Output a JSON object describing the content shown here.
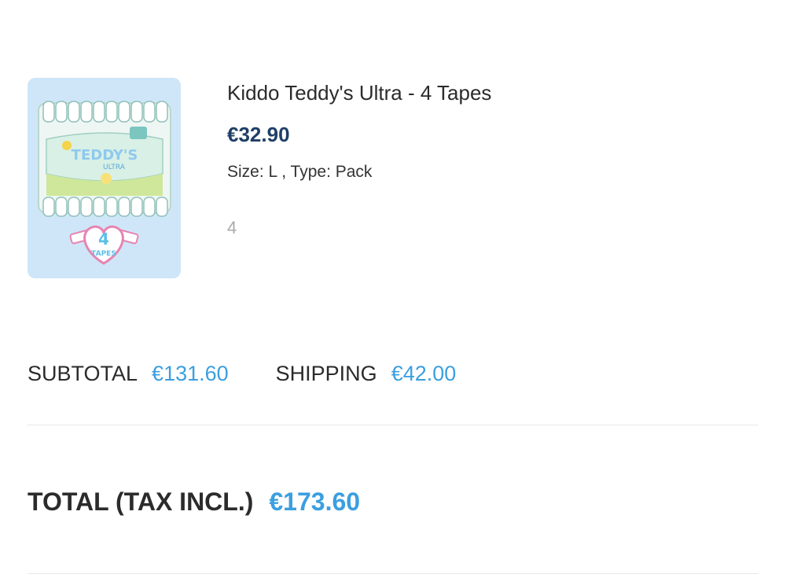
{
  "product": {
    "image_alt": "Teddy's Ultra 4 Tapes pack",
    "image_text": "TEDDY'S ULTRA",
    "badge_text": "4 TAPES",
    "name": "Kiddo Teddy's Ultra - 4 Tapes",
    "price": "€32.90",
    "attributes": "Size: L , Type: Pack",
    "quantity": "4"
  },
  "summary": {
    "subtotal_label": "SUBTOTAL",
    "subtotal_value": "€131.60",
    "shipping_label": "SHIPPING",
    "shipping_value": "€42.00"
  },
  "total": {
    "label": "TOTAL (TAX INCL.)",
    "value": "€173.60"
  },
  "colors": {
    "price": "#1f3f66",
    "accent": "#3b9fe0",
    "thumb_bg": "#cfe6f8"
  }
}
